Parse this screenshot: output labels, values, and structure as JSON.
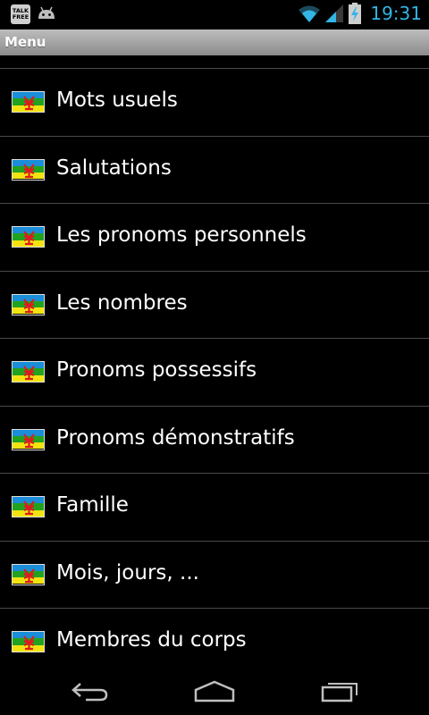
{
  "status_bar": {
    "notifications": [
      {
        "icon": "talk-free-icon",
        "text_lines": [
          "TALK",
          "FREE"
        ]
      },
      {
        "icon": "android-icon"
      }
    ],
    "icons": [
      "wifi-icon",
      "signal-icon",
      "battery-charging-icon"
    ],
    "time": "19:31",
    "accent_color": "#33b5e5"
  },
  "title_bar": {
    "title": "Menu"
  },
  "menu": {
    "items": [
      {
        "label": "Mots usuels",
        "icon": "amazigh-flag-icon"
      },
      {
        "label": "Salutations",
        "icon": "amazigh-flag-icon"
      },
      {
        "label": "Les pronoms personnels",
        "icon": "amazigh-flag-icon"
      },
      {
        "label": "Les nombres",
        "icon": "amazigh-flag-icon"
      },
      {
        "label": "Pronoms possessifs",
        "icon": "amazigh-flag-icon"
      },
      {
        "label": "Pronoms démonstratifs",
        "icon": "amazigh-flag-icon"
      },
      {
        "label": "Famille",
        "icon": "amazigh-flag-icon"
      },
      {
        "label": "Mois, jours, ...",
        "icon": "amazigh-flag-icon"
      },
      {
        "label": "Membres du corps",
        "icon": "amazigh-flag-icon"
      }
    ]
  },
  "nav_bar": {
    "buttons": [
      "back-icon",
      "home-icon",
      "recent-apps-icon"
    ]
  }
}
